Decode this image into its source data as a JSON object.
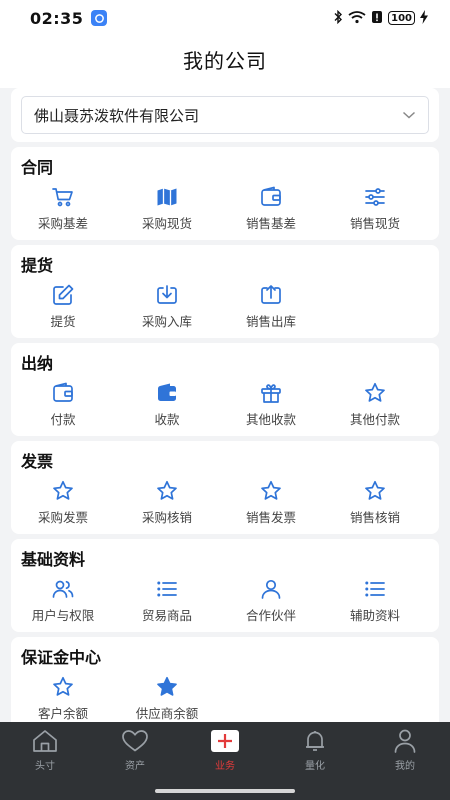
{
  "status_bar": {
    "time": "02:35",
    "battery": "100"
  },
  "header": {
    "title": "我的公司"
  },
  "company": {
    "name": "佛山聂苏泼软件有限公司"
  },
  "sections": [
    {
      "title": "合同",
      "items": [
        {
          "label": "采购基差",
          "icon": "cart-icon"
        },
        {
          "label": "采购现货",
          "icon": "map-icon"
        },
        {
          "label": "销售基差",
          "icon": "wallet-icon"
        },
        {
          "label": "销售现货",
          "icon": "sliders-icon"
        }
      ]
    },
    {
      "title": "提货",
      "items": [
        {
          "label": "提货",
          "icon": "edit-icon"
        },
        {
          "label": "采购入库",
          "icon": "download-icon"
        },
        {
          "label": "销售出库",
          "icon": "upload-icon"
        }
      ]
    },
    {
      "title": "出纳",
      "items": [
        {
          "label": "付款",
          "icon": "wallet-icon"
        },
        {
          "label": "收款",
          "icon": "wallet-filled-icon"
        },
        {
          "label": "其他收款",
          "icon": "gift-icon"
        },
        {
          "label": "其他付款",
          "icon": "star-icon"
        }
      ]
    },
    {
      "title": "发票",
      "items": [
        {
          "label": "采购发票",
          "icon": "star-icon"
        },
        {
          "label": "采购核销",
          "icon": "star-icon"
        },
        {
          "label": "销售发票",
          "icon": "star-icon"
        },
        {
          "label": "销售核销",
          "icon": "star-icon"
        }
      ]
    },
    {
      "title": "基础资料",
      "items": [
        {
          "label": "用户与权限",
          "icon": "users-icon"
        },
        {
          "label": "贸易商品",
          "icon": "list-icon"
        },
        {
          "label": "合作伙伴",
          "icon": "user-icon"
        },
        {
          "label": "辅助资料",
          "icon": "list-icon"
        }
      ]
    },
    {
      "title": "保证金中心",
      "items": [
        {
          "label": "客户余额",
          "icon": "star-icon"
        },
        {
          "label": "供应商余额",
          "icon": "star-filled-icon"
        }
      ]
    }
  ],
  "tabbar": [
    {
      "label": "头寸",
      "icon": "home-icon",
      "active": false
    },
    {
      "label": "资产",
      "icon": "heart-icon",
      "active": false
    },
    {
      "label": "业务",
      "icon": "plus-icon",
      "active": true
    },
    {
      "label": "量化",
      "icon": "bell-icon",
      "active": false
    },
    {
      "label": "我的",
      "icon": "person-icon",
      "active": false
    }
  ],
  "colors": {
    "accent": "#2f74d8",
    "tab_active": "#e33b3b",
    "tabbar_bg": "#2f3235"
  }
}
